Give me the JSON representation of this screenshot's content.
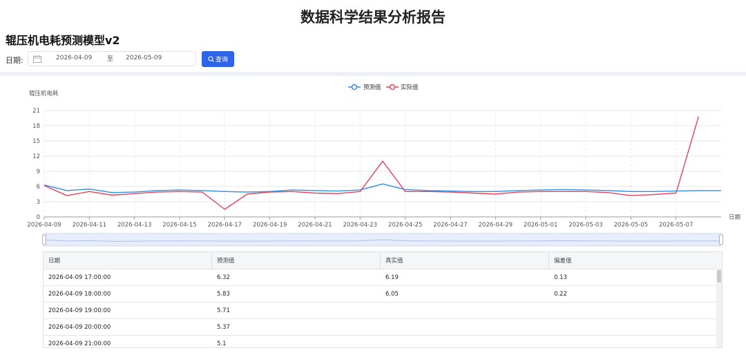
{
  "header": {
    "report_title": "数据科学结果分析报告",
    "model_title": "辊压机电耗预测模型v2"
  },
  "filter": {
    "date_label": "日期:",
    "start_date": "2026-04-09",
    "separator": "至",
    "end_date": "2026-05-09",
    "query_label": "查询",
    "icons": [
      "calendar-icon",
      "search-icon"
    ]
  },
  "colors": {
    "predicted": "#2f8ee0",
    "actual": "#e8405b",
    "accent": "#2f63e8"
  },
  "chart_data": {
    "type": "line",
    "ylabel": "辊压机电耗",
    "xlabel": "日期",
    "ylim": [
      0,
      21
    ],
    "yticks": [
      "0",
      "3",
      "6",
      "9",
      "12",
      "15",
      "18",
      "21"
    ],
    "xlim": [
      "2026-04-09",
      "2026-05-09"
    ],
    "xticks": [
      "2026-04-09",
      "2026-04-11",
      "2026-04-13",
      "2026-04-15",
      "2026-04-17",
      "2026-04-19",
      "2026-04-21",
      "2026-04-23",
      "2026-04-25",
      "2026-04-27",
      "2026-04-29",
      "2026-05-01",
      "2026-05-03",
      "2026-05-05",
      "2026-05-07"
    ],
    "legend_position": "top-center",
    "grid": true,
    "datazoom_slider": true,
    "series": [
      {
        "name": "预测值",
        "points": [
          [
            "2026-04-09",
            6.3
          ],
          [
            "2026-04-10",
            5.2
          ],
          [
            "2026-04-11",
            5.5
          ],
          [
            "2026-04-12",
            4.8
          ],
          [
            "2026-04-13",
            4.9
          ],
          [
            "2026-04-14",
            5.2
          ],
          [
            "2026-04-15",
            5.3
          ],
          [
            "2026-04-16",
            5.2
          ],
          [
            "2026-04-17",
            5.0
          ],
          [
            "2026-04-18",
            4.9
          ],
          [
            "2026-04-19",
            5.0
          ],
          [
            "2026-04-20",
            5.3
          ],
          [
            "2026-04-21",
            5.2
          ],
          [
            "2026-04-22",
            5.1
          ],
          [
            "2026-04-23",
            5.3
          ],
          [
            "2026-04-24",
            6.5
          ],
          [
            "2026-04-25",
            5.4
          ],
          [
            "2026-04-26",
            5.2
          ],
          [
            "2026-04-27",
            5.1
          ],
          [
            "2026-04-28",
            5.0
          ],
          [
            "2026-04-29",
            5.0
          ],
          [
            "2026-04-30",
            5.2
          ],
          [
            "2026-05-01",
            5.3
          ],
          [
            "2026-05-02",
            5.4
          ],
          [
            "2026-05-03",
            5.3
          ],
          [
            "2026-05-04",
            5.2
          ],
          [
            "2026-05-05",
            5.0
          ],
          [
            "2026-05-06",
            5.0
          ],
          [
            "2026-05-07",
            5.1
          ],
          [
            "2026-05-08",
            5.2
          ],
          [
            "2026-05-09",
            5.2
          ]
        ]
      },
      {
        "name": "实际值",
        "points": [
          [
            "2026-04-09",
            6.2
          ],
          [
            "2026-04-10",
            4.2
          ],
          [
            "2026-04-11",
            5.0
          ],
          [
            "2026-04-12",
            4.3
          ],
          [
            "2026-04-13",
            4.6
          ],
          [
            "2026-04-14",
            4.9
          ],
          [
            "2026-04-15",
            5.0
          ],
          [
            "2026-04-16",
            4.9
          ],
          [
            "2026-04-17",
            1.5
          ],
          [
            "2026-04-18",
            4.5
          ],
          [
            "2026-04-19",
            4.9
          ],
          [
            "2026-04-20",
            5.0
          ],
          [
            "2026-04-21",
            4.7
          ],
          [
            "2026-04-22",
            4.6
          ],
          [
            "2026-04-23",
            5.0
          ],
          [
            "2026-04-24",
            11.0
          ],
          [
            "2026-04-25",
            5.0
          ],
          [
            "2026-04-26",
            5.0
          ],
          [
            "2026-04-27",
            4.9
          ],
          [
            "2026-04-28",
            4.7
          ],
          [
            "2026-04-29",
            4.5
          ],
          [
            "2026-04-30",
            4.9
          ],
          [
            "2026-05-01",
            5.0
          ],
          [
            "2026-05-02",
            5.0
          ],
          [
            "2026-05-03",
            5.0
          ],
          [
            "2026-05-04",
            4.8
          ],
          [
            "2026-05-05",
            4.2
          ],
          [
            "2026-05-06",
            4.4
          ],
          [
            "2026-05-07",
            4.7
          ],
          [
            "2026-05-08",
            19.8
          ]
        ]
      }
    ]
  },
  "table": {
    "headers": [
      "日期",
      "预测值",
      "真实值",
      "偏差值"
    ],
    "rows": [
      [
        "2026-04-09 17:00:00",
        "6.32",
        "6.19",
        "0.13"
      ],
      [
        "2026-04-09 18:00:00",
        "5.83",
        "6.05",
        "0.22"
      ],
      [
        "2026-04-09 19:00:00",
        "5.71",
        "",
        ""
      ],
      [
        "2026-04-09 20:00:00",
        "5.37",
        "",
        ""
      ],
      [
        "2026-04-09 21:00:00",
        "5.1",
        "",
        ""
      ]
    ]
  }
}
